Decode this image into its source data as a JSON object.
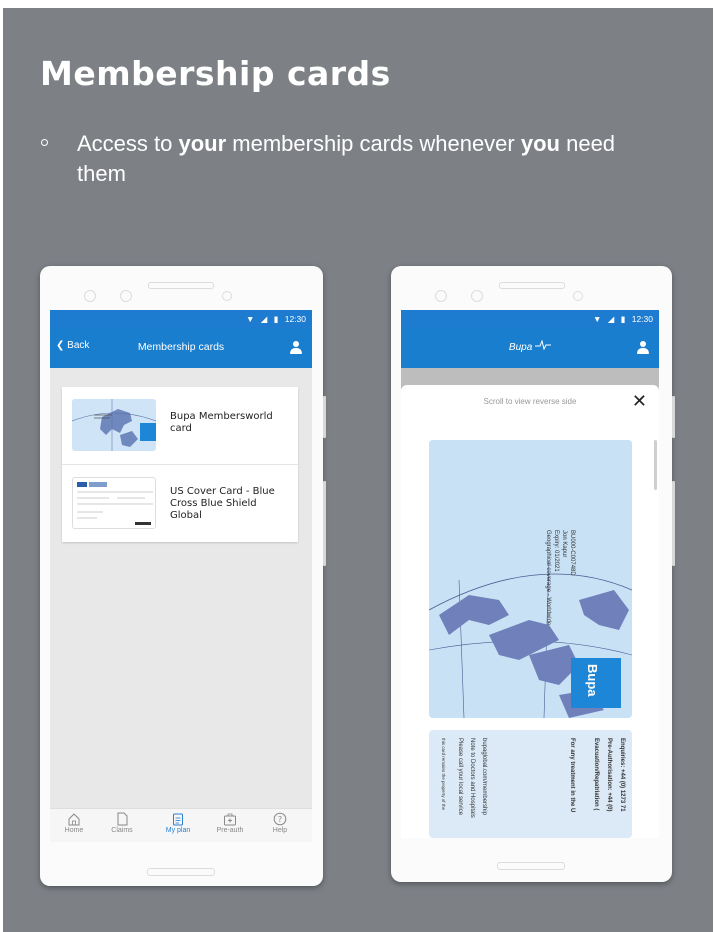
{
  "slide": {
    "title": "Membership cards",
    "bullet": {
      "part1": "Access to ",
      "bold1": "your",
      "part2": " membership cards whenever ",
      "bold2": "you",
      "part3": " need them"
    }
  },
  "left_phone": {
    "status_time": "12:30",
    "back_label": "Back",
    "title": "Membership cards",
    "cards": [
      {
        "label": "Bupa Membersworld card"
      },
      {
        "label": "US Cover Card - Blue Cross Blue Shield Global"
      }
    ],
    "nav": [
      {
        "label": "Home",
        "icon": "home-icon"
      },
      {
        "label": "Claims",
        "icon": "document-icon"
      },
      {
        "label": "My plan",
        "icon": "clipboard-icon",
        "active": true
      },
      {
        "label": "Pre-auth",
        "icon": "medical-case-icon"
      },
      {
        "label": "Help",
        "icon": "help-icon"
      }
    ]
  },
  "right_phone": {
    "status_time": "12:30",
    "logo_text": "Bupa",
    "modal_hint": "Scroll to view reverse side",
    "close_label": "✕",
    "card_front_lines": [
      "BU000-C00748D",
      "Jon Kapur",
      "Expiry: 01/2021",
      "Geographical coverage - Worldwide"
    ],
    "card_badge": "Bupa",
    "card_back_lines": [
      "Enquiries: +44 (0) 1273 71",
      "Pre-Authorisation: +44 (0)",
      "Evacuation/Repatriation (",
      "For any treatment in the U",
      "bupaglobal.com/membership",
      "Note to Doctors and Hospitals",
      "Please call your local service",
      "this card remains the property of the"
    ]
  },
  "colors": {
    "slide_background": "#7d8186",
    "app_blue": "#1a7ecf",
    "card_blue": "#c9e1f5"
  }
}
